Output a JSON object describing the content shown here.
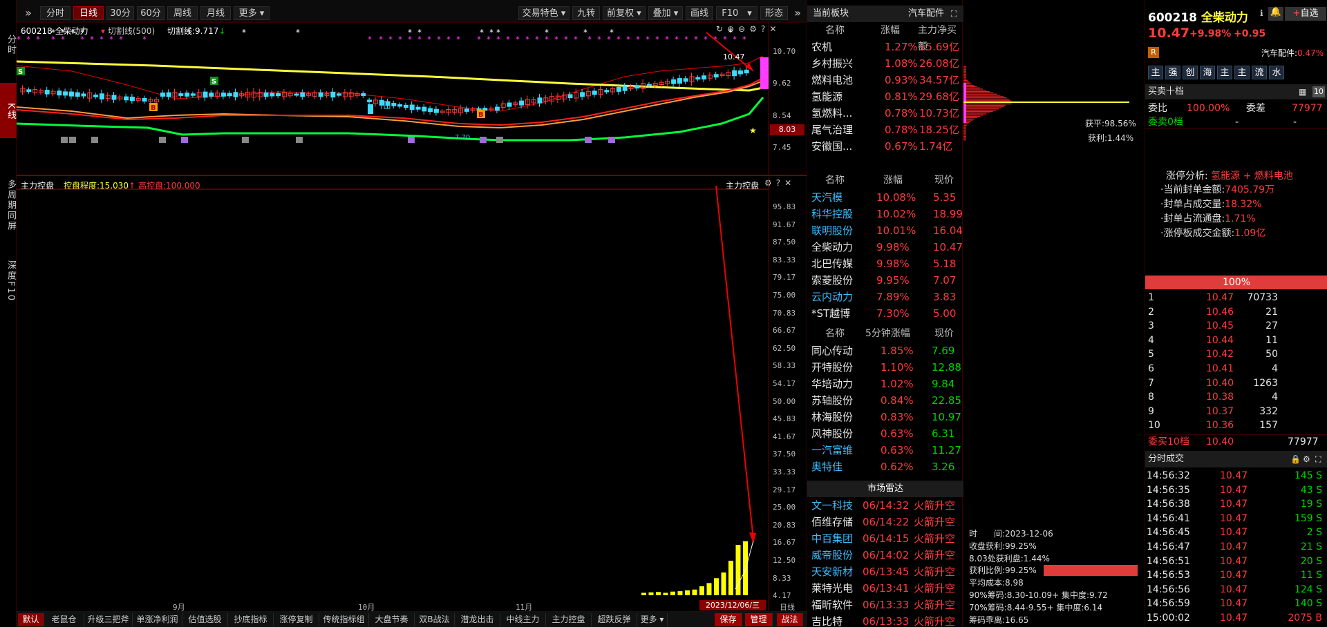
{
  "left_tabs": [
    "分时",
    "K线",
    "多周期同屏",
    "深度F10"
  ],
  "toolbar": {
    "left": [
      "分时",
      "日线",
      "30分",
      "60分",
      "周线",
      "月线",
      "更多"
    ],
    "right": [
      "交易特色",
      "九转",
      "前复权",
      "叠加",
      "画线",
      "F10",
      "形态"
    ]
  },
  "main_chart": {
    "stock": "600218 全柴动力",
    "indicator": "切割线(500)",
    "indicator_value": "切割线:9.717",
    "y_labels": [
      "10.70",
      "9.62",
      "8.54",
      "7.45"
    ],
    "last_price_tag": "8.03",
    "high_label": "10.47",
    "low_label": "7.70"
  },
  "sub_chart": {
    "title": "主力控盘",
    "value1": "控盘程度:15.030",
    "value2": "高控盘:100.000",
    "right_title": "主力控盘",
    "y_labels": [
      "95.83",
      "91.67",
      "87.50",
      "83.33",
      "79.17",
      "75.00",
      "70.83",
      "66.67",
      "62.50",
      "58.33",
      "54.17",
      "50.00",
      "45.83",
      "41.67",
      "37.50",
      "33.33",
      "29.17",
      "25.00",
      "20.83",
      "16.67",
      "12.50",
      "8.33",
      "4.17"
    ],
    "x_labels": [
      "9月",
      "10月",
      "11月"
    ],
    "date_tag": "2023/12/06/三",
    "period": "日线",
    "bars": [
      0.6,
      0.7,
      0.8,
      0.6,
      0.9,
      1.0,
      1.2,
      1.4,
      2.2,
      3.0,
      4.2,
      5.6,
      8.5,
      12.4,
      13.3
    ],
    "chart_data": {
      "type": "bar",
      "title": "主力控盘",
      "ylim": [
        0,
        100
      ],
      "values": [
        0.6,
        0.7,
        0.8,
        0.6,
        0.9,
        1.0,
        1.2,
        1.4,
        2.2,
        3.0,
        4.2,
        5.6,
        8.5,
        12.4,
        13.3
      ]
    }
  },
  "bottom_tabs": [
    "默认",
    "老鼠仓",
    "升级三把斧",
    "单涨净利润",
    "估值选股",
    "抄底指标",
    "涨停复制",
    "传统指标组",
    "大盘节奏",
    "双B战法",
    "潜龙出击",
    "中线主力",
    "主力控盘",
    "超跌反弹",
    "更多"
  ],
  "bottom_right": [
    "保存",
    "管理",
    "战法"
  ],
  "sector": {
    "title": "当前板块",
    "sub": "汽车配件",
    "headers": [
      "名称",
      "涨幅",
      "主力净买额"
    ],
    "rows": [
      {
        "n": "农机",
        "c": "1.27%",
        "v": "15.69亿"
      },
      {
        "n": "乡村振兴",
        "c": "1.08%",
        "v": "26.08亿"
      },
      {
        "n": "燃料电池",
        "c": "0.93%",
        "v": "34.57亿"
      },
      {
        "n": "氢能源",
        "c": "0.81%",
        "v": "29.68亿"
      },
      {
        "n": "氢燃料...",
        "c": "0.78%",
        "v": "10.73亿"
      },
      {
        "n": "尾气治理",
        "c": "0.78%",
        "v": "18.25亿"
      },
      {
        "n": "安徽国...",
        "c": "0.67%",
        "v": "1.74亿"
      }
    ]
  },
  "stocks1": {
    "headers": [
      "名称",
      "涨幅",
      "现价"
    ],
    "rows": [
      {
        "n": "天汽模",
        "c": "10.08%",
        "p": "5.35",
        "col": "cyan"
      },
      {
        "n": "科华控股",
        "c": "10.02%",
        "p": "18.99",
        "col": "cyan"
      },
      {
        "n": "联明股份",
        "c": "10.01%",
        "p": "16.04",
        "col": "cyan"
      },
      {
        "n": "全柴动力",
        "c": "9.98%",
        "p": "10.47",
        "col": "wht"
      },
      {
        "n": "北巴传媒",
        "c": "9.98%",
        "p": "5.18",
        "col": "wht"
      },
      {
        "n": "索菱股份",
        "c": "9.95%",
        "p": "7.07",
        "col": "wht"
      },
      {
        "n": "云内动力",
        "c": "7.89%",
        "p": "3.83",
        "col": "cyan"
      },
      {
        "n": "*ST越博",
        "c": "7.30%",
        "p": "5.00",
        "col": "wht"
      }
    ]
  },
  "stocks2": {
    "headers": [
      "名称",
      "5分钟涨幅",
      "现价"
    ],
    "rows": [
      {
        "n": "同心传动",
        "c": "1.85%",
        "p": "7.69",
        "col": "wht"
      },
      {
        "n": "开特股份",
        "c": "1.10%",
        "p": "12.88",
        "col": "wht"
      },
      {
        "n": "华培动力",
        "c": "1.02%",
        "p": "9.84",
        "col": "wht"
      },
      {
        "n": "苏轴股份",
        "c": "0.84%",
        "p": "22.85",
        "col": "wht"
      },
      {
        "n": "林海股份",
        "c": "0.83%",
        "p": "10.97",
        "col": "wht"
      },
      {
        "n": "风神股份",
        "c": "0.63%",
        "p": "6.31",
        "col": "wht"
      },
      {
        "n": "一汽富维",
        "c": "0.63%",
        "p": "11.27",
        "col": "cyan"
      },
      {
        "n": "奥特佳",
        "c": "0.62%",
        "p": "3.26",
        "col": "cyan"
      }
    ]
  },
  "radar": {
    "title": "市场雷达",
    "rows": [
      {
        "n": "文一科技",
        "t": "06/14:32",
        "e": "火箭升空",
        "col": "cyan"
      },
      {
        "n": "佰维存储",
        "t": "06/14:22",
        "e": "火箭升空",
        "col": "wht"
      },
      {
        "n": "中百集团",
        "t": "06/14:15",
        "e": "火箭升空",
        "col": "cyan"
      },
      {
        "n": "威帝股份",
        "t": "06/14:02",
        "e": "火箭升空",
        "col": "cyan"
      },
      {
        "n": "天安新材",
        "t": "06/13:45",
        "e": "火箭升空",
        "col": "cyan"
      },
      {
        "n": "莱特光电",
        "t": "06/13:41",
        "e": "火箭升空",
        "col": "wht"
      },
      {
        "n": "福昕软件",
        "t": "06/13:33",
        "e": "火箭升空",
        "col": "wht"
      },
      {
        "n": "吉比特",
        "t": "06/13:33",
        "e": "火箭升空",
        "col": "wht"
      }
    ]
  },
  "chip": {
    "avg_label": "获平:98.56%",
    "profit_label": "获利:1.44%",
    "lines": [
      "时　　间:2023-12-06",
      "收盘获利:99.25%",
      "8.03处获利盘:1.44%",
      "获利比例:99.25%",
      "平均成本:8.98",
      "90%筹码:8.30-10.09+ 集中度:9.72",
      "70%筹码:8.44-9.55+ 集中度:6.14",
      "筹码乖离:16.65"
    ]
  },
  "quote": {
    "code": "600218",
    "name": "全柴动力",
    "price": "10.47",
    "pct": "+9.98%",
    "chg": "+0.95",
    "sector": "汽车配件:",
    "sector_pct": "0.47%",
    "icons": [
      "主",
      "强",
      "创",
      "海",
      "主",
      "主",
      "流",
      "水"
    ],
    "add": "自选"
  },
  "orderbook": {
    "title": "买卖十档",
    "ratio_label": "委比",
    "ratio": "100.00%",
    "diff_label": "委差",
    "diff": "77977",
    "sell_label": "委卖0档",
    "dash1": "-",
    "dash2": "-",
    "limit_title": "涨停分析:",
    "limit_tags": "氢能源 + 燃料电池",
    "limit_lines": [
      {
        "l": "·当前封单金额:",
        "v": "7405.79万"
      },
      {
        "l": "·封单占成交量:",
        "v": "18.32%"
      },
      {
        "l": "·封单占流通盘:",
        "v": "1.71%"
      },
      {
        "l": "·涨停板成交金额:",
        "v": "1.09亿"
      }
    ],
    "pct_bar": "100%",
    "bids": [
      {
        "i": "1",
        "p": "10.47",
        "v": "70733"
      },
      {
        "i": "2",
        "p": "10.46",
        "v": "21"
      },
      {
        "i": "3",
        "p": "10.45",
        "v": "27"
      },
      {
        "i": "4",
        "p": "10.44",
        "v": "11"
      },
      {
        "i": "5",
        "p": "10.42",
        "v": "50"
      },
      {
        "i": "6",
        "p": "10.41",
        "v": "4"
      },
      {
        "i": "7",
        "p": "10.40",
        "v": "1263"
      },
      {
        "i": "8",
        "p": "10.38",
        "v": "4"
      },
      {
        "i": "9",
        "p": "10.37",
        "v": "332"
      },
      {
        "i": "10",
        "p": "10.36",
        "v": "157"
      }
    ],
    "buy_label": "委买10档",
    "buy_price": "10.40",
    "buy_vol": "77977"
  },
  "ticks": {
    "title": "分时成交",
    "rows": [
      {
        "t": "14:56:32",
        "p": "10.47",
        "v": "145 S"
      },
      {
        "t": "14:56:35",
        "p": "10.47",
        "v": "43 S"
      },
      {
        "t": "14:56:38",
        "p": "10.47",
        "v": "19 S"
      },
      {
        "t": "14:56:41",
        "p": "10.47",
        "v": "159 S"
      },
      {
        "t": "14:56:45",
        "p": "10.47",
        "v": "2 S"
      },
      {
        "t": "14:56:47",
        "p": "10.47",
        "v": "21 S"
      },
      {
        "t": "14:56:51",
        "p": "10.47",
        "v": "20 S"
      },
      {
        "t": "14:56:53",
        "p": "10.47",
        "v": "11 S"
      },
      {
        "t": "14:56:56",
        "p": "10.47",
        "v": "124 S"
      },
      {
        "t": "14:56:59",
        "p": "10.47",
        "v": "140 S"
      },
      {
        "t": "15:00:02",
        "p": "10.47",
        "v": "2075 B"
      }
    ]
  }
}
